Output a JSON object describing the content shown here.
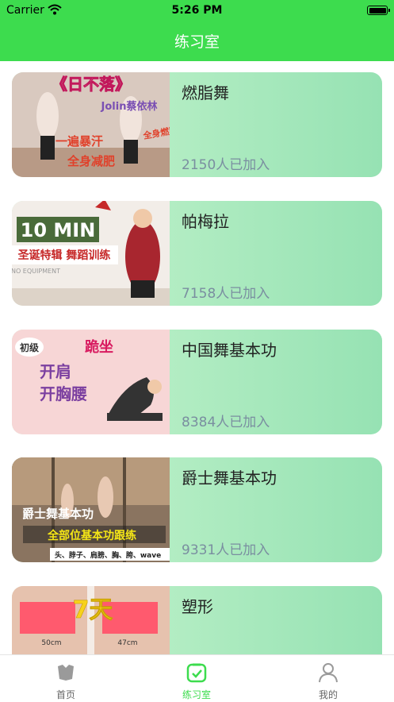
{
  "status_bar": {
    "carrier": "Carrier",
    "time": "5:26 PM"
  },
  "nav": {
    "title": "练习室"
  },
  "courses": [
    {
      "title": "燃脂舞",
      "joined": "2150人已加入",
      "thumb_text": {
        "top": "《日不落》",
        "artist": "Jolin蔡依林",
        "line1": "一遍暴汗",
        "line2": "全身减肥",
        "side": "全身燃脂"
      }
    },
    {
      "title": "帕梅拉",
      "joined": "7158人已加入",
      "thumb_text": {
        "badge": "10 MIN",
        "sub": "圣诞特辑 舞蹈训练",
        "small": "NO EQUIPMENT"
      }
    },
    {
      "title": "中国舞基本功",
      "joined": "8384人已加入",
      "thumb_text": {
        "tag": "初级",
        "pose": "跪坐",
        "line1": "开肩",
        "line2": "开胸腰"
      }
    },
    {
      "title": "爵士舞基本功",
      "joined": "9331人已加入",
      "thumb_text": {
        "line1": "爵士舞基本功",
        "line2": "全部位基本功跟练",
        "line3": "头、脖子、肩膀、胸、胯、wave"
      }
    },
    {
      "title": "塑形",
      "joined": "",
      "thumb_text": {
        "big": "7天",
        "left": "50cm",
        "right": "47cm"
      }
    }
  ],
  "tabs": [
    {
      "label": "首页",
      "icon": "home-icon"
    },
    {
      "label": "练习室",
      "icon": "practice-icon"
    },
    {
      "label": "我的",
      "icon": "profile-icon"
    }
  ],
  "colors": {
    "accent": "#3ddc4e",
    "card_start": "#c8f5cf",
    "card_end": "#96e2b3"
  }
}
